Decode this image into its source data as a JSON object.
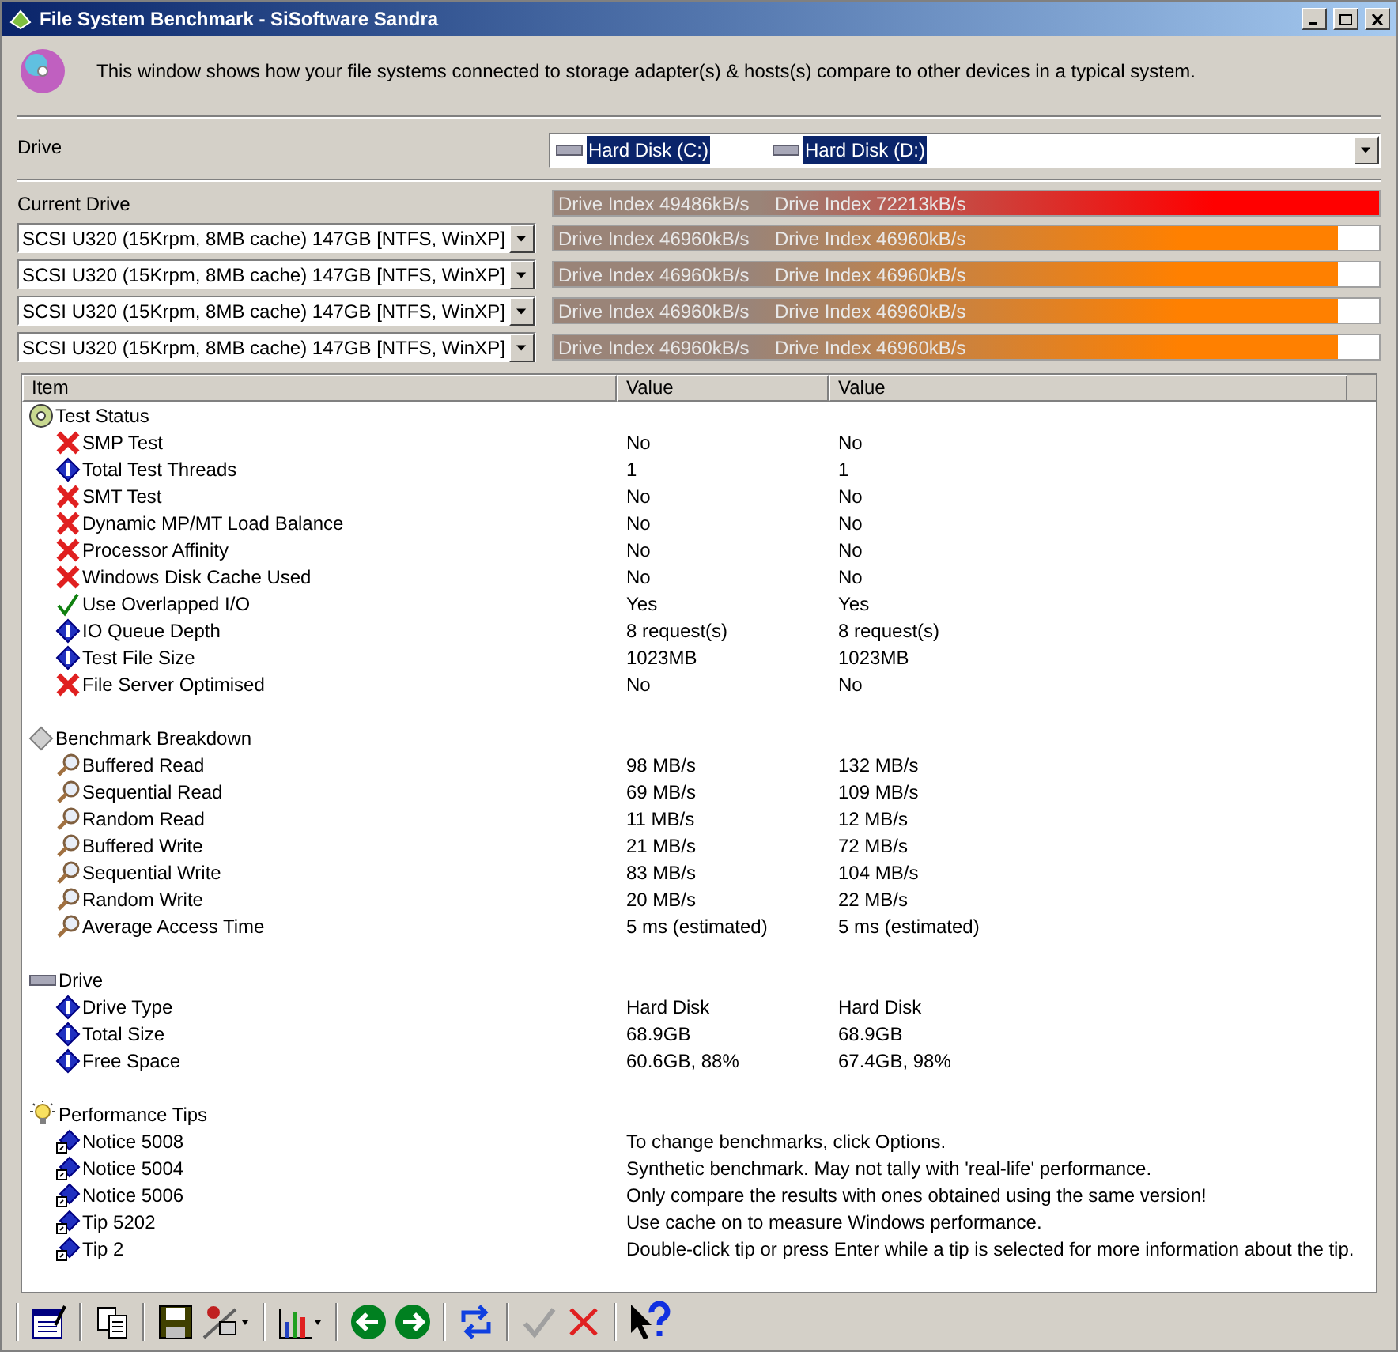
{
  "window": {
    "title": "File System Benchmark - SiSoftware Sandra"
  },
  "description": "This window shows how your file systems connected to storage adapter(s) & hosts(s) compare to other devices in a typical system.",
  "drive": {
    "label": "Drive",
    "selections": [
      "Hard Disk (C:)",
      "Hard Disk (D:)"
    ]
  },
  "current": {
    "label": "Current Drive",
    "bar": {
      "readings": [
        "Drive Index 49486kB/s",
        "Drive Index 72213kB/s"
      ],
      "level": 1,
      "color": "#ff0000"
    }
  },
  "references": [
    {
      "device": "SCSI U320 (15Krpm, 8MB cache) 147GB [NTFS, WinXP]",
      "bar": {
        "readings": [
          "Drive Index 46960kB/s",
          "Drive Index 46960kB/s"
        ],
        "level": 0.95,
        "color": "#ff8000"
      }
    },
    {
      "device": "SCSI U320 (15Krpm, 8MB cache) 147GB [NTFS, WinXP]",
      "bar": {
        "readings": [
          "Drive Index 46960kB/s",
          "Drive Index 46960kB/s"
        ],
        "level": 0.95,
        "color": "#ff8000"
      }
    },
    {
      "device": "SCSI U320 (15Krpm, 8MB cache) 147GB [NTFS, WinXP]",
      "bar": {
        "readings": [
          "Drive Index 46960kB/s",
          "Drive Index 46960kB/s"
        ],
        "level": 0.95,
        "color": "#ff8000"
      }
    },
    {
      "device": "SCSI U320 (15Krpm, 8MB cache) 147GB [NTFS, WinXP]",
      "bar": {
        "readings": [
          "Drive Index 46960kB/s",
          "Drive Index 46960kB/s"
        ],
        "level": 0.95,
        "color": "#ff8000"
      }
    }
  ],
  "table": {
    "columns": [
      "Item",
      "Value",
      "Value"
    ],
    "groups": [
      {
        "kind": "disc",
        "name": "Test Status",
        "children": [
          {
            "kind": "cross",
            "name": "SMP Test",
            "values": [
              "No",
              "No"
            ]
          },
          {
            "kind": "info",
            "name": "Total Test Threads",
            "values": [
              "1",
              "1"
            ]
          },
          {
            "kind": "cross",
            "name": "SMT Test",
            "values": [
              "No",
              "No"
            ]
          },
          {
            "kind": "cross",
            "name": "Dynamic MP/MT Load Balance",
            "values": [
              "No",
              "No"
            ]
          },
          {
            "kind": "cross",
            "name": "Processor Affinity",
            "values": [
              "No",
              "No"
            ]
          },
          {
            "kind": "cross",
            "name": "Windows Disk Cache Used",
            "values": [
              "No",
              "No"
            ]
          },
          {
            "kind": "check",
            "name": "Use Overlapped I/O",
            "values": [
              "Yes",
              "Yes"
            ]
          },
          {
            "kind": "info",
            "name": "IO Queue Depth",
            "values": [
              "8 request(s)",
              "8 request(s)"
            ]
          },
          {
            "kind": "info",
            "name": "Test File Size",
            "values": [
              "1023MB",
              "1023MB"
            ]
          },
          {
            "kind": "cross",
            "name": "File Server Optimised",
            "values": [
              "No",
              "No"
            ]
          }
        ]
      },
      {
        "kind": "diamond",
        "name": "Benchmark Breakdown",
        "children": [
          {
            "kind": "search",
            "name": "Buffered Read",
            "values": [
              "98 MB/s",
              "132 MB/s"
            ]
          },
          {
            "kind": "search",
            "name": "Sequential Read",
            "values": [
              "69 MB/s",
              "109 MB/s"
            ]
          },
          {
            "kind": "search",
            "name": "Random Read",
            "values": [
              "11 MB/s",
              "12 MB/s"
            ]
          },
          {
            "kind": "search",
            "name": "Buffered Write",
            "values": [
              "21 MB/s",
              "72 MB/s"
            ]
          },
          {
            "kind": "search",
            "name": "Sequential Write",
            "values": [
              "83 MB/s",
              "104 MB/s"
            ]
          },
          {
            "kind": "search",
            "name": "Random Write",
            "values": [
              "20 MB/s",
              "22 MB/s"
            ]
          },
          {
            "kind": "search",
            "name": "Average Access Time",
            "values": [
              "5 ms (estimated)",
              "5 ms (estimated)"
            ]
          }
        ]
      },
      {
        "kind": "drive",
        "name": "Drive",
        "children": [
          {
            "kind": "info",
            "name": "Drive Type",
            "values": [
              "Hard Disk",
              "Hard Disk"
            ]
          },
          {
            "kind": "info",
            "name": "Total Size",
            "values": [
              "68.9GB",
              "68.9GB"
            ]
          },
          {
            "kind": "info",
            "name": "Free Space",
            "values": [
              "60.6GB, 88%",
              "67.4GB, 98%"
            ]
          }
        ]
      },
      {
        "kind": "bulb",
        "name": "Performance Tips",
        "children": [
          {
            "kind": "tip",
            "name": "Notice 5008",
            "values": [
              "To change benchmarks, click Options."
            ]
          },
          {
            "kind": "tip",
            "name": "Notice 5004",
            "values": [
              "Synthetic benchmark. May not tally with 'real-life' performance."
            ]
          },
          {
            "kind": "tip",
            "name": "Notice 5006",
            "values": [
              "Only compare the results with ones obtained using the same version!"
            ]
          },
          {
            "kind": "tip",
            "name": "Tip 5202",
            "values": [
              "Use cache on to measure Windows performance."
            ]
          },
          {
            "kind": "tip",
            "name": "Tip 2",
            "values": [
              "Double-click tip or press Enter while a tip is selected for more information about the tip."
            ]
          }
        ]
      }
    ]
  }
}
